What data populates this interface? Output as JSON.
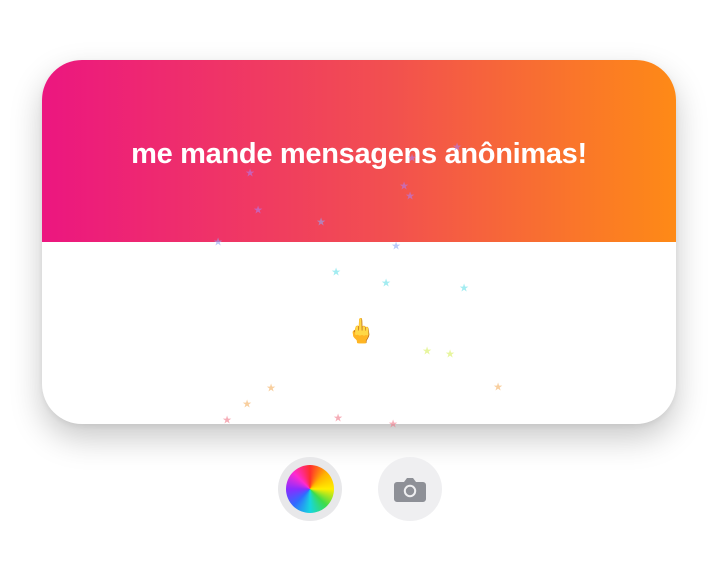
{
  "card": {
    "title": "me mande mensagens anônimas!",
    "gradient_start": "#ec1680",
    "gradient_end": "#fe8a16",
    "emoji": "🖕"
  },
  "controls": {
    "color_button_icon": "color-wheel-icon",
    "camera_button_icon": "camera-icon",
    "camera_icon_color": "#8e9097",
    "button_background": "#efeff1"
  },
  "confetti": {
    "glyph": "★",
    "colors": [
      "#b07cf0",
      "#8fa8f5",
      "#67e0e8",
      "#d8f060",
      "#f5b060",
      "#f07888"
    ]
  }
}
